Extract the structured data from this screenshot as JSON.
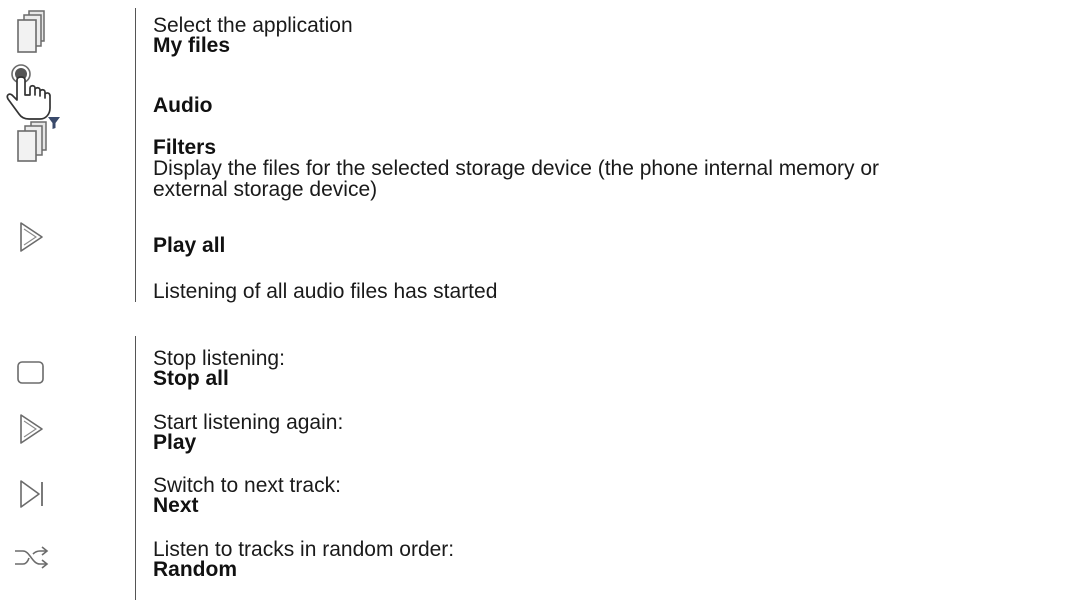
{
  "steps": {
    "select_app": {
      "instruction": "Select the application",
      "label": "My files",
      "icon": "stacked-files-icon"
    },
    "tap_audio": {
      "label": "Audio",
      "icon": "tap-hand-icon"
    },
    "filters": {
      "label": "Filters",
      "description_line1": "Display the files for the selected storage device (the phone internal memory or",
      "description_line2": "external storage device)",
      "icon": "filter-files-icon"
    },
    "play_all": {
      "label": "Play all",
      "icon": "play-icon"
    },
    "result": {
      "text": "Listening of all audio files has started"
    }
  },
  "options": [
    {
      "instruction": "Stop listening:",
      "label": "Stop all",
      "icon": "stop-square-icon"
    },
    {
      "instruction": "Start listening again:",
      "label": "Play",
      "icon": "play-icon"
    },
    {
      "instruction": "Switch to next track:",
      "label": "Next",
      "icon": "next-track-icon"
    },
    {
      "instruction": "Listen to tracks in random order:",
      "label": "Random",
      "icon": "shuffle-icon"
    }
  ],
  "colors": {
    "icon_stroke": "#6b6b6b",
    "icon_fill_light": "#e9e9e9",
    "filter_accent": "#3a4a6b",
    "divider": "#555555"
  }
}
